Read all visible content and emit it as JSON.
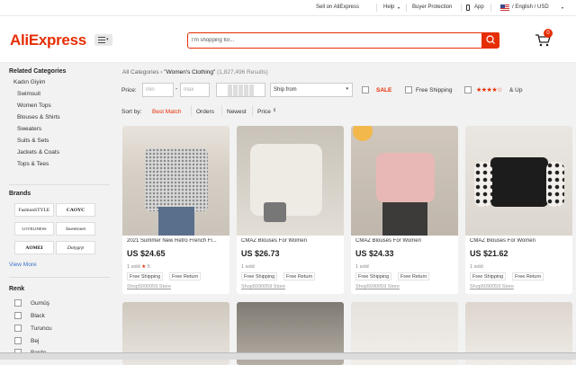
{
  "topbar": {
    "sell": "Sell on AliExpress",
    "help": "Help",
    "buyer_protection": "Buyer Protection",
    "app": "App",
    "locale": "/ English / USD"
  },
  "header": {
    "logo": "AliExpress",
    "search_placeholder": "I'm shopping for...",
    "cart_count": "0"
  },
  "sidebar": {
    "related_title": "Related Categories",
    "parent": "Kadın Giyim",
    "items": [
      "Swimsuit",
      "Women Tops",
      "Blouses & Shirts",
      "Sweaters",
      "Suits & Sets",
      "Jackets & Coats",
      "Tops & Tees"
    ],
    "brands_title": "Brands",
    "brands": [
      "FashionSTYLE",
      "CAOYC",
      "LOVELINESS",
      "Sweetown",
      "AOMEI",
      "Dotygrp"
    ],
    "view_more": "View More",
    "renk_title": "Renk",
    "colors": [
      "Gumüş",
      "Black",
      "Turuncu",
      "Bej",
      "Bordo"
    ]
  },
  "breadcrumb": {
    "all": "All Categories",
    "arrow": "›",
    "query": "\"Women's Clothing\"",
    "count": "(1,827,496 Results)"
  },
  "filters": {
    "price_label": "Price:",
    "min": "min",
    "dash": "-",
    "max": "max",
    "ship_from": "Ship from",
    "sale": "SALE",
    "free_shipping": "Free Shipping",
    "stars": "★★★★☆",
    "and_up": "& Up"
  },
  "sort": {
    "label": "Sort by:",
    "best_match": "Best Match",
    "orders": "Orders",
    "newest": "Newest",
    "price": "Price"
  },
  "products": [
    {
      "title": "2021 Summer New Retro French Fl...",
      "price": "US $24.65",
      "sold": "1 sold",
      "rating": "5",
      "tags": [
        "Free Shipping",
        "Free Return"
      ],
      "store": "Shop5090059 Store"
    },
    {
      "title": "CMAZ Blouses For Women",
      "price": "US $26.73",
      "sold": "1 sold",
      "tags": [
        "Free Shipping",
        "Free Return"
      ],
      "store": "Shop5090059 Store"
    },
    {
      "title": "CMAZ Blouses For Women",
      "price": "US $24.33",
      "sold": "1 sold",
      "tags": [
        "Free Shipping",
        "Free Return"
      ],
      "store": "Shop5090059 Store"
    },
    {
      "title": "CMAZ Blouses For Women",
      "price": "US $21.62",
      "sold": "1 sold",
      "tags": [
        "Free Shipping",
        "Free Return"
      ],
      "store": "Shop5090059 Store"
    }
  ],
  "colors": {
    "brand": "#e62e04",
    "accent_star": "#e62e04"
  }
}
